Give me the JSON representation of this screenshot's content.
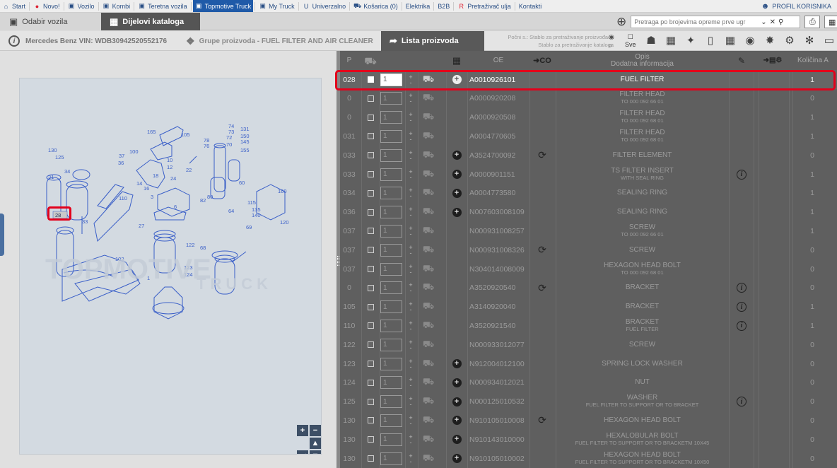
{
  "topnav": {
    "items": [
      {
        "label": "Start",
        "icon": "home-icon",
        "glyph": "⌂"
      },
      {
        "label": "Novo!",
        "icon": "new-badge-icon",
        "glyph": "●"
      },
      {
        "label": "Vozilo",
        "icon": "car-icon",
        "glyph": "▣"
      },
      {
        "label": "Kombi",
        "icon": "van-icon",
        "glyph": "▣"
      },
      {
        "label": "Teretna vozila",
        "icon": "truck-icon",
        "glyph": "▣"
      },
      {
        "label": "Topmotive Truck",
        "icon": "topmotive-truck-icon",
        "glyph": "▣",
        "active": true
      },
      {
        "label": "My Truck",
        "icon": "my-truck-icon",
        "glyph": "▣"
      },
      {
        "label": "Univerzalno",
        "icon": "universal-icon",
        "glyph": "U"
      },
      {
        "label": "Košarica (0)",
        "icon": "cart-icon",
        "glyph": "⛟"
      },
      {
        "label": "Elektrika",
        "icon": "",
        "glyph": ""
      },
      {
        "label": "B2B",
        "icon": "",
        "glyph": ""
      },
      {
        "label": "Pretraživač ulja",
        "icon": "oil-search-icon",
        "glyph": "R"
      },
      {
        "label": "Kontakti",
        "icon": "",
        "glyph": ""
      }
    ],
    "profile": "PROFIL KORISNIKA"
  },
  "subbar": {
    "tab_vehicle": "Odabir vozila",
    "tab_catalog": "Dijelovi kataloga",
    "search_placeholder": "Pretraga po brojevima opreme prve ugr"
  },
  "infobar": {
    "vehicle": "Mercedes Benz VIN: WDB30942520552176",
    "group": "Grupe proizvoda - FUEL FILTER AND AIR CLEANER",
    "lista": "Lista proizvoda",
    "start_line1": "Počni s.: Stablo za pretraživanje proizvođača",
    "start_line2": "Stablo za pretraživanje kataloga",
    "sve": "Sve"
  },
  "table": {
    "headers": {
      "p": "P",
      "oe": "OE",
      "opis1": "Opis",
      "opis2": "Dodatna informacija",
      "kolicina": "Količina A"
    },
    "rows": [
      {
        "pos": "028",
        "qty": "1",
        "plus": true,
        "oe": "A0010926101",
        "change": false,
        "desc": "FUEL FILTER",
        "sub": "",
        "info": false,
        "kol": "1",
        "selected": true
      },
      {
        "pos": "0",
        "qty": "1",
        "plus": false,
        "oe": "A0000920208",
        "change": false,
        "desc": "FILTER HEAD",
        "sub": "TO 000 092 66 01",
        "info": false,
        "kol": "0"
      },
      {
        "pos": "0",
        "qty": "1",
        "plus": false,
        "oe": "A0000920508",
        "change": false,
        "desc": "FILTER HEAD",
        "sub": "TO 000 092 68 01",
        "info": false,
        "kol": "1"
      },
      {
        "pos": "031",
        "qty": "1",
        "plus": false,
        "oe": "A0004770605",
        "change": false,
        "desc": "FILTER HEAD",
        "sub": "TO 000 092 68 01",
        "info": false,
        "kol": "1"
      },
      {
        "pos": "033",
        "qty": "1",
        "plus": true,
        "oe": "A3524700092",
        "change": true,
        "desc": "FILTER ELEMENT",
        "sub": "",
        "info": false,
        "kol": "0"
      },
      {
        "pos": "033",
        "qty": "1",
        "plus": true,
        "oe": "A0000901151",
        "change": false,
        "desc": "TS FILTER INSERT",
        "sub": "WITH SEAL RING",
        "info": true,
        "kol": "1"
      },
      {
        "pos": "034",
        "qty": "1",
        "plus": true,
        "oe": "A0004773580",
        "change": false,
        "desc": "SEALING RING",
        "sub": "",
        "info": false,
        "kol": "1"
      },
      {
        "pos": "036",
        "qty": "1",
        "plus": true,
        "oe": "N007603008109",
        "change": false,
        "desc": "SEALING RING",
        "sub": "",
        "info": false,
        "kol": "1"
      },
      {
        "pos": "037",
        "qty": "1",
        "plus": false,
        "oe": "N000931008257",
        "change": false,
        "desc": "SCREW",
        "sub": "TO 000 092 66 01",
        "info": false,
        "kol": "1"
      },
      {
        "pos": "037",
        "qty": "1",
        "plus": false,
        "oe": "N000931008326",
        "change": true,
        "desc": "SCREW",
        "sub": "",
        "info": false,
        "kol": "0"
      },
      {
        "pos": "037",
        "qty": "1",
        "plus": false,
        "oe": "N304014008009",
        "change": false,
        "desc": "HEXAGON HEAD BOLT",
        "sub": "TO 000 092 68 01",
        "info": false,
        "kol": "0"
      },
      {
        "pos": "0",
        "qty": "1",
        "plus": false,
        "oe": "A3520920540",
        "change": true,
        "desc": "BRACKET",
        "sub": "",
        "info": true,
        "kol": "0"
      },
      {
        "pos": "105",
        "qty": "1",
        "plus": false,
        "oe": "A3140920040",
        "change": false,
        "desc": "BRACKET",
        "sub": "",
        "info": true,
        "kol": "1"
      },
      {
        "pos": "110",
        "qty": "1",
        "plus": false,
        "oe": "A3520921540",
        "change": false,
        "desc": "BRACKET",
        "sub": "FUEL FILTER",
        "info": true,
        "kol": "1"
      },
      {
        "pos": "122",
        "qty": "1",
        "plus": false,
        "oe": "N000933012077",
        "change": false,
        "desc": "SCREW",
        "sub": "",
        "info": false,
        "kol": "0"
      },
      {
        "pos": "123",
        "qty": "1",
        "plus": true,
        "oe": "N912004012100",
        "change": false,
        "desc": "SPRING LOCK WASHER",
        "sub": "",
        "info": false,
        "kol": "0"
      },
      {
        "pos": "124",
        "qty": "1",
        "plus": true,
        "oe": "N000934012021",
        "change": false,
        "desc": "NUT",
        "sub": "",
        "info": false,
        "kol": "0"
      },
      {
        "pos": "125",
        "qty": "1",
        "plus": true,
        "oe": "N000125010532",
        "change": false,
        "desc": "WASHER",
        "sub": "FUEL FILTER TO SUPPORT OR TO BRACKET",
        "info": true,
        "kol": "0"
      },
      {
        "pos": "130",
        "qty": "1",
        "plus": true,
        "oe": "N910105010008",
        "change": true,
        "desc": "HEXAGON HEAD BOLT",
        "sub": "",
        "info": false,
        "kol": "0"
      },
      {
        "pos": "130",
        "qty": "1",
        "plus": true,
        "oe": "N910143010000",
        "change": false,
        "desc": "HEXALOBULAR BOLT",
        "sub": "FUEL FILTER TO SUPPORT OR TO BRACKETM 10X45",
        "info": false,
        "kol": "0"
      },
      {
        "pos": "130",
        "qty": "1",
        "plus": true,
        "oe": "N910105010002",
        "change": false,
        "desc": "HEXAGON HEAD BOLT",
        "sub": "FUEL FILTER TO SUPPORT OR TO BRACKETM 10X50",
        "info": false,
        "kol": "0"
      }
    ]
  },
  "diagram": {
    "labels": [
      "130",
      "125",
      "37",
      "36",
      "100",
      "165",
      "105",
      "78",
      "76",
      "74",
      "73",
      "131",
      "150",
      "145",
      "72",
      "70",
      "155",
      "10",
      "12",
      "24",
      "22",
      "18",
      "14",
      "16",
      "3",
      "6",
      "34",
      "31",
      "110",
      "160",
      "115",
      "135",
      "120",
      "140",
      "82",
      "80",
      "64",
      "60",
      "69",
      "33",
      "27",
      "122",
      "68",
      "102",
      "123",
      "124",
      "1",
      "28"
    ],
    "watermark_big": "TOPMOTIVE",
    "watermark_small": "TRUCK",
    "highlight_label": "28"
  },
  "colors": {
    "highlight": "#e3001b",
    "nav_active": "#1f5aa8",
    "diagram_line": "#3a5fc8"
  }
}
